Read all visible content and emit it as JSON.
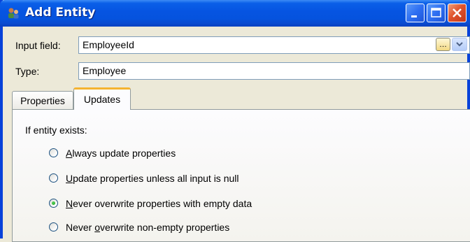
{
  "window": {
    "title": "Add Entity",
    "title_color": "#FFFFFF",
    "accent_color": "#0A5FE8"
  },
  "form": {
    "input_field": {
      "label": "Input field:",
      "value": "EmployeeId"
    },
    "type": {
      "label": "Type:",
      "value": "Employee"
    }
  },
  "tabs": [
    {
      "label": "Properties",
      "selected": false
    },
    {
      "label": "Updates",
      "selected": true
    }
  ],
  "updates": {
    "group_label": "If entity exists:",
    "options": [
      {
        "mnemonic": "A",
        "rest": "lways update properties",
        "checked": false
      },
      {
        "mnemonic": "U",
        "rest": "pdate properties unless all input is null",
        "checked": false
      },
      {
        "mnemonic": "N",
        "rest": "ever overwrite properties with empty data",
        "checked": true
      },
      {
        "prefix": "Never ",
        "mnemonic": "o",
        "rest": "verwrite non-empty properties",
        "checked": false
      }
    ]
  }
}
